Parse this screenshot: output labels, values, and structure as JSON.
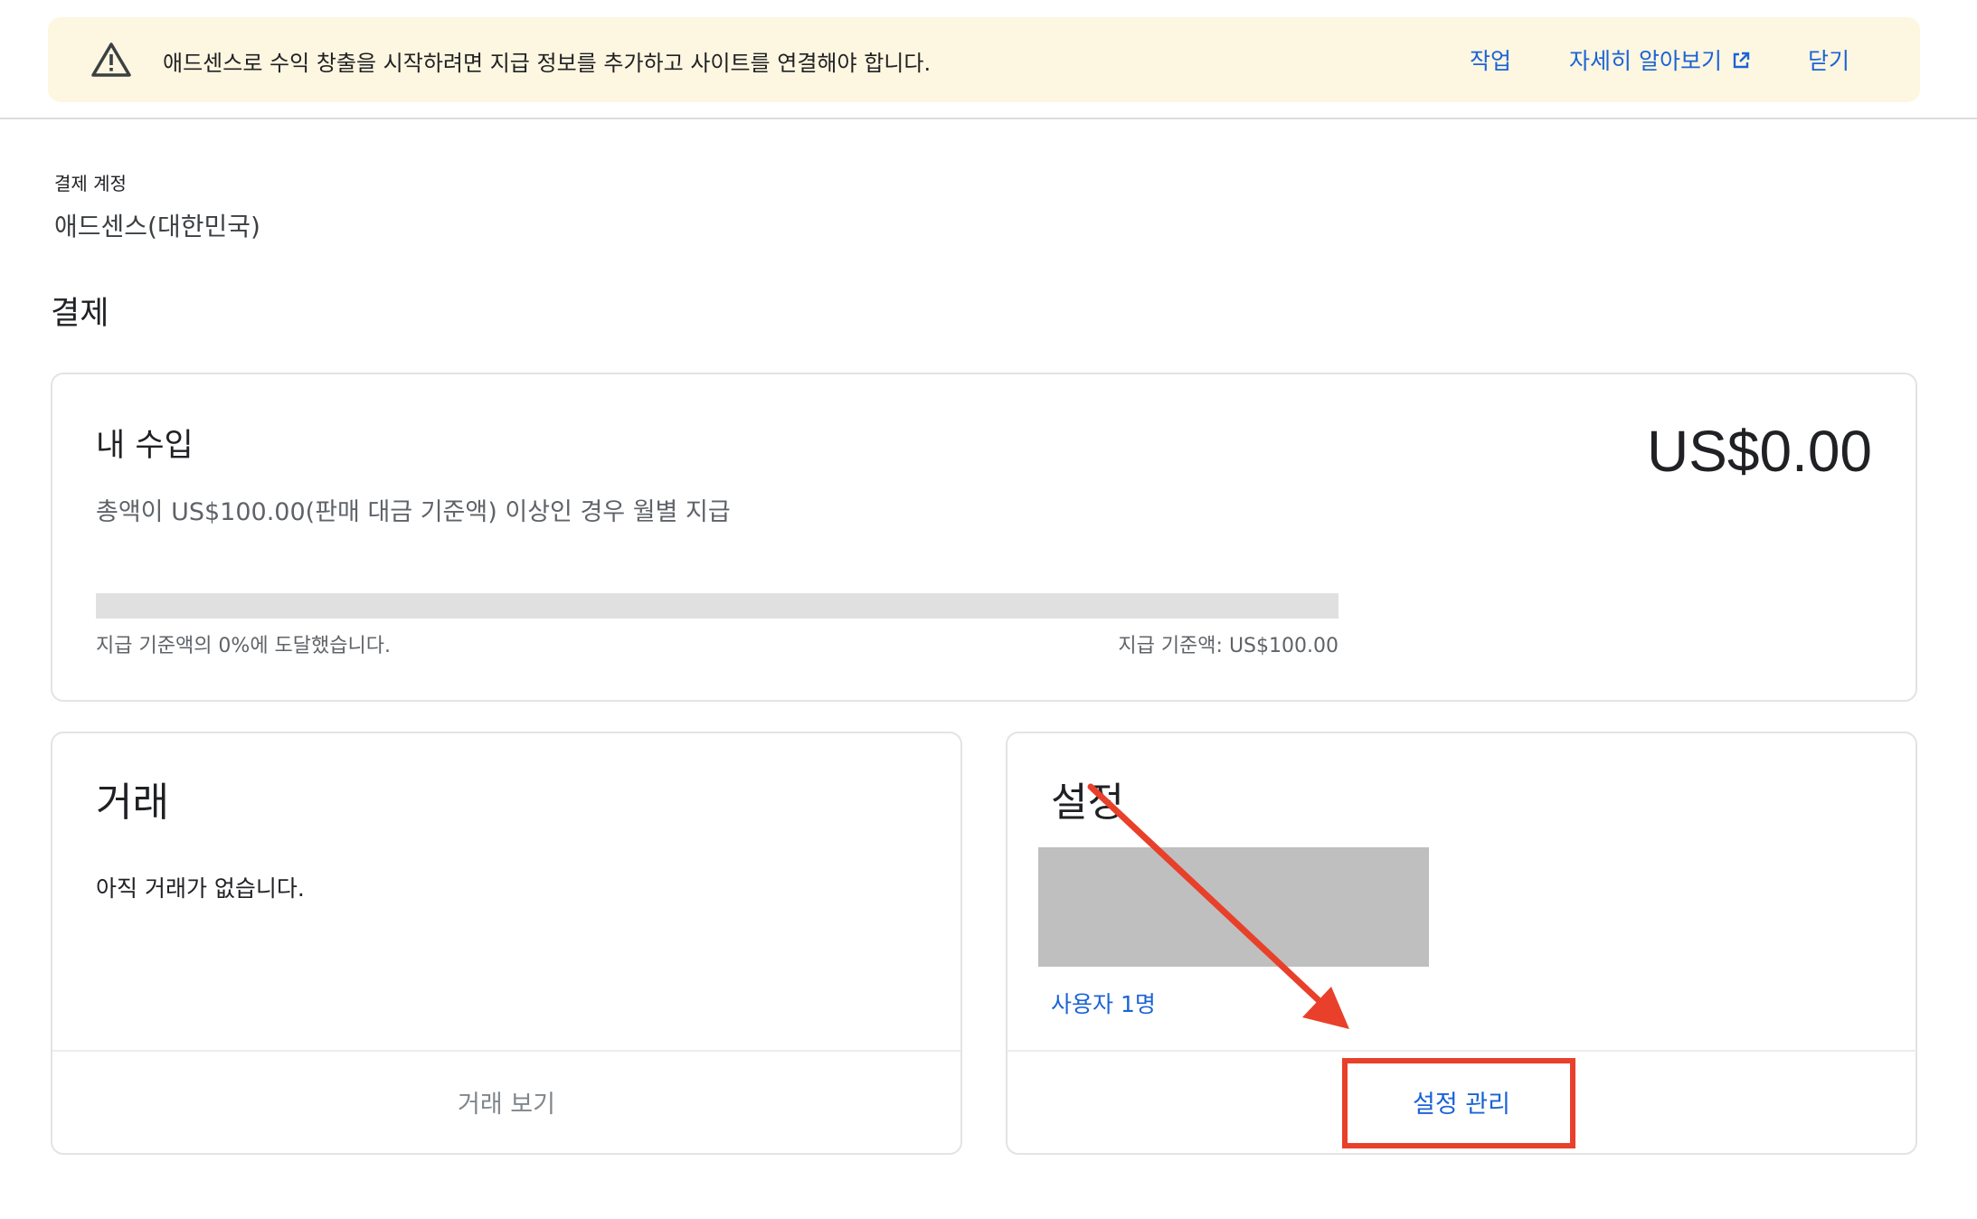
{
  "banner": {
    "message": "애드센스로 수익 창출을 시작하려면 지급 정보를 추가하고 사이트를 연결해야 합니다.",
    "action_label": "작업",
    "learn_more_label": "자세히 알아보기",
    "close_label": "닫기",
    "icon": "warning-triangle-icon",
    "background_color": "#fdf6e0"
  },
  "billing_account": {
    "label": "결제 계정",
    "value": "애드센스(대한민국)"
  },
  "page": {
    "section_title": "결제"
  },
  "earnings": {
    "title": "내 수입",
    "amount": "US$0.00",
    "threshold_note": "총액이 US$100.00(판매 대금 기준액) 이상인 경우 월별 지급",
    "progress_percent": 0,
    "progress_text": "지급 기준액의 0%에 도달했습니다.",
    "threshold_text": "지급 기준액: US$100.00"
  },
  "transactions": {
    "title": "거래",
    "empty_message": "아직 거래가 없습니다.",
    "view_button": "거래 보기"
  },
  "settings": {
    "title": "설정",
    "users_link": "사용자 1명",
    "manage_button": "설정 관리"
  },
  "annotation": {
    "arrow_color": "#e8402a",
    "highlight_color": "#e8402a"
  },
  "colors": {
    "link": "#1a63d6"
  }
}
